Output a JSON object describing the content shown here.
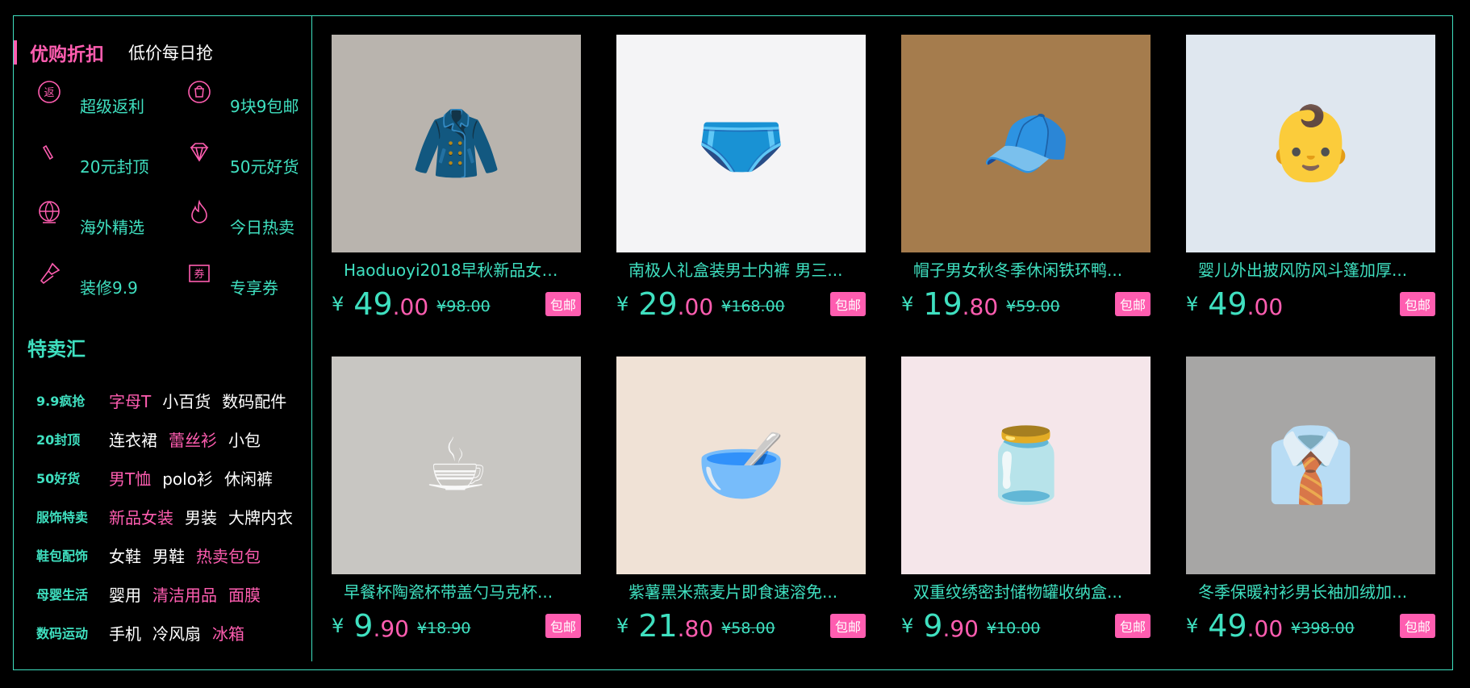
{
  "sidebar": {
    "discount_title": "优购折扣",
    "discount_sub": "低价每日抢",
    "promos": [
      {
        "label": "超级返利",
        "icon": "rebate-icon"
      },
      {
        "label": "9块9包邮",
        "icon": "shopping-bag-icon"
      },
      {
        "label": "20元封顶",
        "icon": "pencil-icon"
      },
      {
        "label": "50元好货",
        "icon": "diamond-icon"
      },
      {
        "label": "海外精选",
        "icon": "globe-icon"
      },
      {
        "label": "今日热卖",
        "icon": "flame-icon"
      },
      {
        "label": "装修9.9",
        "icon": "paint-brush-icon"
      },
      {
        "label": "专享券",
        "icon": "coupon-icon"
      }
    ],
    "special_title": "特卖汇",
    "special": [
      {
        "cat": "9.9疯抢",
        "tags": [
          {
            "t": "字母T",
            "hot": true
          },
          {
            "t": "小百货",
            "hot": false
          },
          {
            "t": "数码配件",
            "hot": false
          }
        ]
      },
      {
        "cat": "20封顶",
        "tags": [
          {
            "t": "连衣裙",
            "hot": false
          },
          {
            "t": "蕾丝衫",
            "hot": true
          },
          {
            "t": "小包",
            "hot": false
          }
        ]
      },
      {
        "cat": "50好货",
        "tags": [
          {
            "t": "男T恤",
            "hot": true
          },
          {
            "t": "polo衫",
            "hot": false
          },
          {
            "t": "休闲裤",
            "hot": false
          }
        ]
      },
      {
        "cat": "服饰特卖",
        "tags": [
          {
            "t": "新品女装",
            "hot": true
          },
          {
            "t": "男装",
            "hot": false
          },
          {
            "t": "大牌内衣",
            "hot": false
          }
        ]
      },
      {
        "cat": "鞋包配饰",
        "tags": [
          {
            "t": "女鞋",
            "hot": false
          },
          {
            "t": "男鞋",
            "hot": false
          },
          {
            "t": "热卖包包",
            "hot": true
          }
        ]
      },
      {
        "cat": "母婴生活",
        "tags": [
          {
            "t": "婴用",
            "hot": false
          },
          {
            "t": "清洁用品",
            "hot": true
          },
          {
            "t": "面膜",
            "hot": true
          }
        ]
      },
      {
        "cat": "数码运动",
        "tags": [
          {
            "t": "手机",
            "hot": false
          },
          {
            "t": "冷风扇",
            "hot": false
          },
          {
            "t": "冰箱",
            "hot": true
          }
        ]
      }
    ]
  },
  "products": [
    {
      "title": "Haoduoyi2018早秋新品女装...",
      "yen": "¥",
      "int": "49",
      "dec": ".00",
      "old": "¥98.00",
      "ship": "包邮",
      "image": "knit-poncho-photo",
      "emoji": "🧥",
      "bg": "#b9b4ae"
    },
    {
      "title": "南极人礼盒装男士内裤 男三...",
      "yen": "¥",
      "int": "29",
      "dec": ".00",
      "old": "¥168.00",
      "ship": "包邮",
      "image": "boxer-briefs-photo",
      "emoji": "🩲",
      "bg": "#f4f4f6"
    },
    {
      "title": "帽子男女秋冬季休闲铁环鸭...",
      "yen": "¥",
      "int": "19",
      "dec": ".80",
      "old": "¥59.00",
      "ship": "包邮",
      "image": "baseball-caps-photo",
      "emoji": "🧢",
      "bg": "#a57c4d"
    },
    {
      "title": "婴儿外出披风防风斗篷加厚...",
      "yen": "¥",
      "int": "49",
      "dec": ".00",
      "old": "",
      "ship": "包邮",
      "image": "baby-cloak-photo",
      "emoji": "👶",
      "bg": "#dfe7ef"
    },
    {
      "title": "早餐杯陶瓷杯带盖勺马克杯...",
      "yen": "¥",
      "int": "9",
      "dec": ".90",
      "old": "¥18.90",
      "ship": "包邮",
      "image": "ceramic-mugs-photo",
      "emoji": "☕",
      "bg": "#c8c6c2"
    },
    {
      "title": "紫薯黑米燕麦片即食速溶免...",
      "yen": "¥",
      "int": "21",
      "dec": ".80",
      "old": "¥58.00",
      "ship": "包邮",
      "image": "oatmeal-packs-photo",
      "emoji": "🥣",
      "bg": "#f0e2d6"
    },
    {
      "title": "双重纹绣密封储物罐收纳盒...",
      "yen": "¥",
      "int": "9",
      "dec": ".90",
      "old": "¥10.00",
      "ship": "包邮",
      "image": "storage-jars-photo",
      "emoji": "🫙",
      "bg": "#f5e6ea"
    },
    {
      "title": "冬季保暖衬衫男长袖加绒加...",
      "yen": "¥",
      "int": "49",
      "dec": ".00",
      "old": "¥398.00",
      "ship": "包邮",
      "image": "plaid-shirt-photo",
      "emoji": "👔",
      "bg": "#a7a6a5"
    }
  ],
  "colors": {
    "accent_teal": "#3fe0c0",
    "accent_pink": "#ff5db0",
    "background": "#000000"
  }
}
